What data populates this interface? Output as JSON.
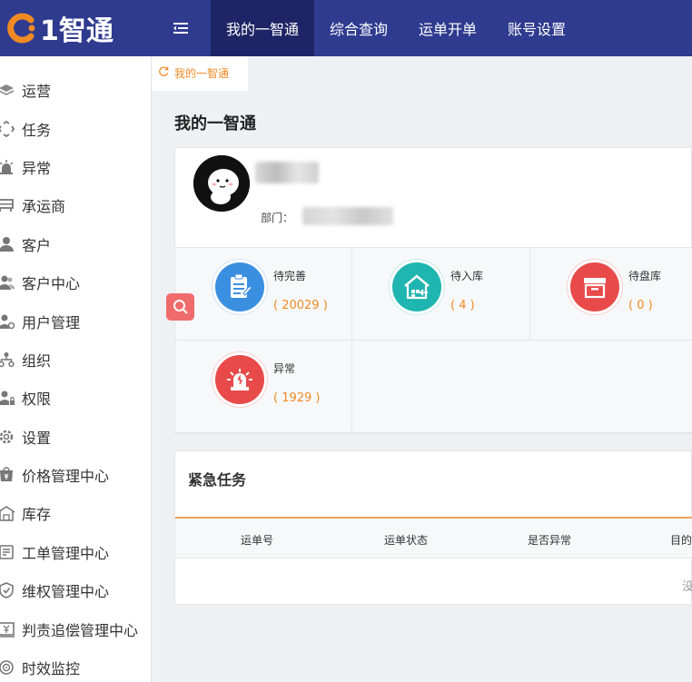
{
  "brand": {
    "name": "1智通"
  },
  "topnav": {
    "items": [
      "我的一智通",
      "综合查询",
      "运单开单",
      "账号设置"
    ],
    "active_index": 0
  },
  "sidebar": {
    "items": [
      {
        "label": "运营",
        "icon": "layers-icon"
      },
      {
        "label": "任务",
        "icon": "task-icon"
      },
      {
        "label": "异常",
        "icon": "alarm-icon"
      },
      {
        "label": "承运商",
        "icon": "truck-icon"
      },
      {
        "label": "客户",
        "icon": "user-icon"
      },
      {
        "label": "客户中心",
        "icon": "users-icon"
      },
      {
        "label": "用户管理",
        "icon": "user-settings-icon"
      },
      {
        "label": "组织",
        "icon": "org-icon"
      },
      {
        "label": "权限",
        "icon": "user-lock-icon"
      },
      {
        "label": "设置",
        "icon": "gear-icon"
      },
      {
        "label": "价格管理中心",
        "icon": "price-icon"
      },
      {
        "label": "库存",
        "icon": "warehouse-icon"
      },
      {
        "label": "工单管理中心",
        "icon": "ticket-icon"
      },
      {
        "label": "维权管理中心",
        "icon": "shield-icon"
      },
      {
        "label": "判责追偿管理中心",
        "icon": "yen-doc-icon"
      },
      {
        "label": "时效监控",
        "icon": "clock-icon"
      }
    ]
  },
  "tab": {
    "label": "我的一智通"
  },
  "page": {
    "title": "我的一智通"
  },
  "profile": {
    "dept_label": "部门："
  },
  "stats": [
    {
      "label": "待完善",
      "count": "( 20029 )",
      "color": "#3b8fe0"
    },
    {
      "label": "待入库",
      "count": "( 4 )",
      "color": "#1fb5b0"
    },
    {
      "label": "待盘库",
      "count": "( 0 )",
      "color": "#e84a4a"
    },
    {
      "label": "异常",
      "count": "( 1929 )",
      "color": "#e84a4a"
    }
  ],
  "urgent": {
    "title": "紧急任务",
    "columns": [
      "运单号",
      "运单状态",
      "是否异常",
      "目的"
    ],
    "empty_text": "没"
  },
  "colors": {
    "topbar": "#2f3b8f",
    "accent": "#f08a24"
  }
}
